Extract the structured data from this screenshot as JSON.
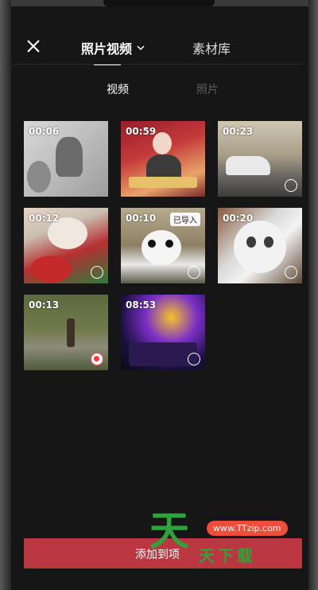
{
  "header": {
    "close_icon": "close-icon",
    "tab_photo_video": "照片视频",
    "tab_material": "素材库"
  },
  "subtabs": {
    "video": "视频",
    "photo": "照片"
  },
  "thumbnails": [
    {
      "duration": "00:06",
      "selected": false
    },
    {
      "duration": "00:59",
      "selected": false
    },
    {
      "duration": "00:23",
      "selected": false
    },
    {
      "duration": "00:12",
      "selected": false
    },
    {
      "duration": "00:10",
      "selected": false,
      "badge": "已导入"
    },
    {
      "duration": "00:20",
      "selected": false
    },
    {
      "duration": "00:13",
      "selected": true
    },
    {
      "duration": "08:53",
      "selected": false
    }
  ],
  "footer": {
    "add_button": "添加到项"
  },
  "watermark": {
    "url": "www.TTzip.com",
    "big": "天",
    "small": "天下载"
  },
  "colors": {
    "accent": "#ba3640",
    "selected_dot": "#ff3348",
    "background": "#161616"
  }
}
